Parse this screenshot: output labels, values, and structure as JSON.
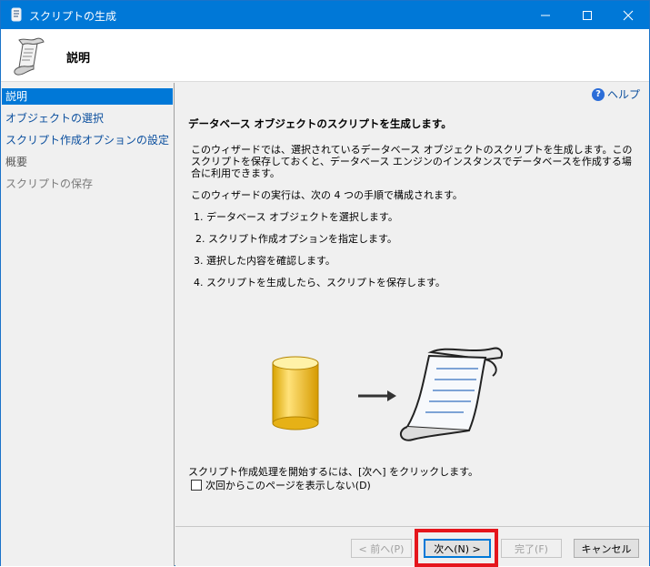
{
  "window": {
    "title": "スクリプトの生成"
  },
  "header": {
    "title": "説明"
  },
  "nav": {
    "items": [
      {
        "label": "説明",
        "state": "selected"
      },
      {
        "label": "オブジェクトの選択",
        "state": "link"
      },
      {
        "label": "スクリプト作成オプションの設定",
        "state": "link"
      },
      {
        "label": "概要",
        "state": "disabled"
      },
      {
        "label": "スクリプトの保存",
        "state": "dim"
      }
    ]
  },
  "main": {
    "help_label": "ヘルプ",
    "title": "データベース オブジェクトのスクリプトを生成します。",
    "paragraph": "このウィザードでは、選択されているデータベース オブジェクトのスクリプトを生成します。このスクリプトを保存しておくと、データベース エンジンのインスタンスでデータベースを作成する場合に利用できます。",
    "steps_intro": "このウィザードの実行は、次の 4 つの手順で構成されます。",
    "steps": [
      "1. データベース オブジェクトを選択します。",
      "2. スクリプト作成オプションを指定します。",
      "3. 選択した内容を確認します。",
      "4. スクリプトを生成したら、スクリプトを保存します。"
    ],
    "start_note": "スクリプト作成処理を開始するには、[次へ] をクリックします。",
    "checkbox_label": "次回からこのページを表示しない(D)",
    "checkbox_checked": false
  },
  "buttons": {
    "prev": "< 前へ(P)",
    "next": "次へ(N) >",
    "finish": "完了(F)",
    "cancel": "キャンセル"
  },
  "colors": {
    "titlebar": "#0078d7",
    "selection": "#0078d7",
    "link": "#0b4f9e",
    "highlight": "#e5161d"
  }
}
